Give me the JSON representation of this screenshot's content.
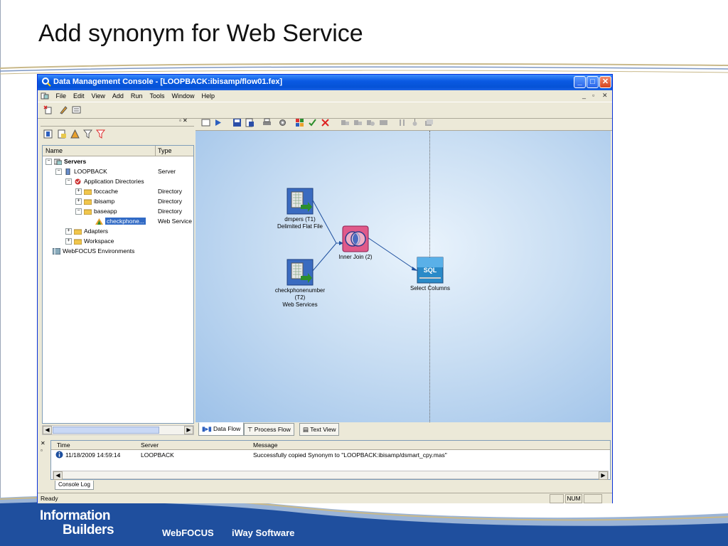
{
  "slide": {
    "title": "Add synonym for Web Service"
  },
  "window": {
    "title": "Data Management Console - [LOOPBACK:ibisamp/flow01.fex]",
    "menu": [
      "File",
      "Edit",
      "View",
      "Add",
      "Run",
      "Tools",
      "Window",
      "Help"
    ]
  },
  "tree": {
    "columns": {
      "name": "Name",
      "type": "Type"
    },
    "items": [
      {
        "label": "Servers",
        "type": ""
      },
      {
        "label": "LOOPBACK",
        "type": "Server"
      },
      {
        "label": "Application Directories",
        "type": ""
      },
      {
        "label": "foccache",
        "type": "Directory"
      },
      {
        "label": "ibisamp",
        "type": "Directory"
      },
      {
        "label": "baseapp",
        "type": "Directory"
      },
      {
        "label": "checkphone...",
        "type": "Web Service"
      },
      {
        "label": "Adapters",
        "type": ""
      },
      {
        "label": "Workspace",
        "type": ""
      },
      {
        "label": "WebFOCUS Environments",
        "type": ""
      }
    ]
  },
  "canvas": {
    "nodes": [
      {
        "line1": "dmpers (T1)",
        "line2": "Delimited Flat File",
        "line3": ""
      },
      {
        "line1": "checkphonenumber",
        "line2": "(T2)",
        "line3": "Web Services"
      },
      {
        "line1": "Inner Join (2)",
        "line2": "",
        "line3": ""
      },
      {
        "line1": "Select Columns",
        "line2": "",
        "line3": "",
        "badge": "SQL"
      }
    ]
  },
  "tabs": [
    "Data Flow",
    "Process Flow",
    "Text View"
  ],
  "log": {
    "columns": {
      "time": "Time",
      "server": "Server",
      "message": "Message"
    },
    "rows": [
      {
        "time": "11/18/2009 14:59:14",
        "server": "LOOPBACK",
        "message": "Successfully copied Synonym to \"LOOPBACK:ibisamp/dsmart_cpy.mas\""
      }
    ],
    "tab": "Console Log"
  },
  "status": {
    "text": "Ready",
    "num": "NUM"
  },
  "footer": {
    "brand_line1": "Information",
    "brand_line2": "Builders",
    "link1": "WebFOCUS",
    "link2": "iWay Software"
  },
  "colors": {
    "titlebar": "#0552d6",
    "footer_blue": "#1f4f9e",
    "selection": "#316ac5"
  }
}
